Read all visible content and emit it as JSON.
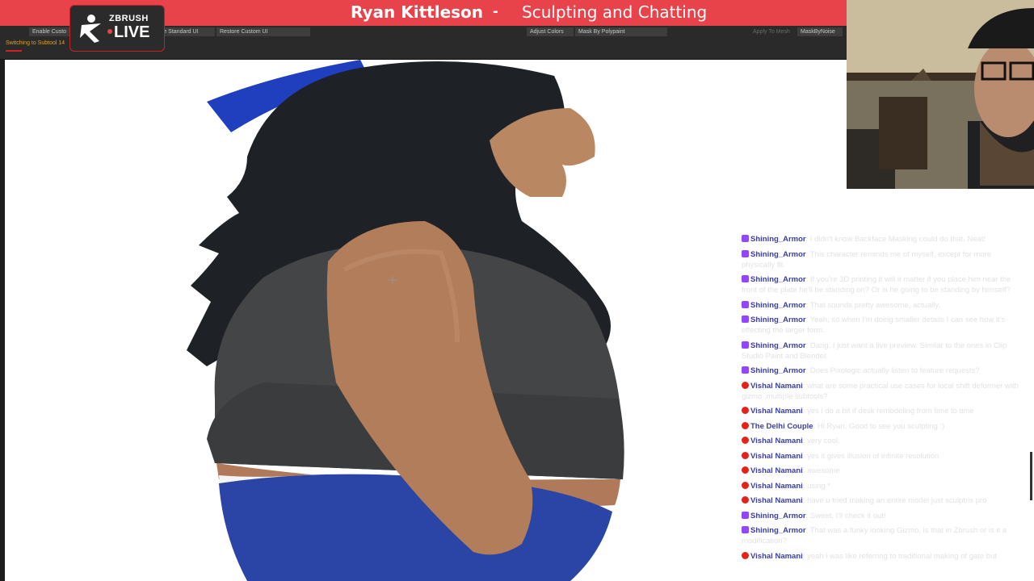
{
  "banner": {
    "name": "Ryan Kittleson",
    "dash": "-",
    "subtitle": "Sculpting and Chatting",
    "color": "#e8424a"
  },
  "logo": {
    "line1": "ZBRUSH",
    "line2": "LIVE"
  },
  "toolbar": {
    "enable_custom": "Enable Custo",
    "store_standard": "re Standard UI",
    "restore_custom": "Restore Custom UI",
    "adjust_colors": "Adjust Colors",
    "mask_by_polypaint": "Mask By Polypaint",
    "apply_to_mesh": "Apply To Mesh",
    "mask_by_noise": "MaskByNoise",
    "status": "Switching to Subtool 14"
  },
  "chat": {
    "messages": [
      {
        "platform": "twitch",
        "user": "Shining_Armor",
        "text": "I didn't know Backface Masking could do that. Neat!"
      },
      {
        "platform": "twitch",
        "user": "Shining_Armor",
        "text": "This character reminds me of myself, except for more physically fit."
      },
      {
        "platform": "twitch",
        "user": "Shining_Armor",
        "text": "If you're 3D printing it will it matter if you place him near the front of the plate he'll be standing on? Or is he going to be standing by himself?"
      },
      {
        "platform": "twitch",
        "user": "Shining_Armor",
        "text": "That sounds pretty awesome, actually."
      },
      {
        "platform": "twitch",
        "user": "Shining_Armor",
        "text": "Yeah, so when I'm doing smaller details I can see how it's effecting the larger form."
      },
      {
        "platform": "twitch",
        "user": "Shining_Armor",
        "text": "Dang. I just want a live preview. Similar to the ones in Clip Studio Paint and Blender."
      },
      {
        "platform": "twitch",
        "user": "Shining_Armor",
        "text": "Does Pixologic actually listen to feature requests?"
      },
      {
        "platform": "youtube",
        "user": "Vishal Namani",
        "text": "what are some practical use cases for local shift deformer with gizmo ,multiple subtools?"
      },
      {
        "platform": "youtube",
        "user": "Vishal Namani",
        "text": "yes i do a bit if desk remodeling from time to time"
      },
      {
        "platform": "youtube",
        "user": "The Delhi Couple",
        "text": "Hi Ryan, Good to see you sculpting :)"
      },
      {
        "platform": "youtube",
        "user": "Vishal Namani",
        "text": "very cool."
      },
      {
        "platform": "youtube",
        "user": "Vishal Namani",
        "text": "yes it gives illusion of infinite resolution"
      },
      {
        "platform": "youtube",
        "user": "Vishal Namani",
        "text": "awesome"
      },
      {
        "platform": "youtube",
        "user": "Vishal Namani",
        "text": "using *"
      },
      {
        "platform": "youtube",
        "user": "Vishal Namani",
        "text": "have u tried making an entire model just sculptris pro"
      },
      {
        "platform": "twitch",
        "user": "Shining_Armor",
        "text": "Sweet, I'll check it out!"
      },
      {
        "platform": "twitch",
        "user": "Shining_Armor",
        "text": "That was a funky looking Gizmo, is that in Zbrush or is it a modification?"
      },
      {
        "platform": "youtube",
        "user": "Vishal Namani",
        "text": "yeah i was like referring to traditional making of gate but"
      }
    ]
  }
}
